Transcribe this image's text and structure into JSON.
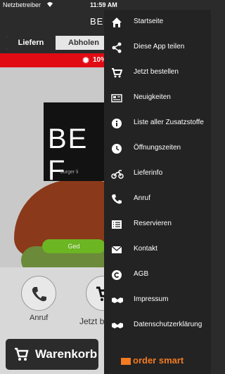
{
  "status": {
    "carrier": "Netzbetreiber",
    "time": "11:59 AM"
  },
  "header": {
    "title": "BE F"
  },
  "tabs": [
    {
      "label": "Liefern",
      "active": true
    },
    {
      "label": "Abholen",
      "active": false
    }
  ],
  "promo": {
    "text": "10%"
  },
  "hero": {
    "logo_big": "BE F",
    "logo_small": "burger li",
    "green_button": "Ged"
  },
  "actions": {
    "call_label": "Anruf",
    "order_label": "Jetzt b"
  },
  "cart": {
    "label": "Warenkorb"
  },
  "drawer": {
    "items": [
      {
        "label": "Startseite",
        "icon": "home-icon"
      },
      {
        "label": "Diese App teilen",
        "icon": "share-icon"
      },
      {
        "label": "Jetzt bestellen",
        "icon": "cart-icon"
      },
      {
        "label": "Neuigkeiten",
        "icon": "news-icon"
      },
      {
        "label": "Liste aller Zusatzstoffe",
        "icon": "info-icon"
      },
      {
        "label": "Öffnungszeiten",
        "icon": "clock-icon"
      },
      {
        "label": "Lieferinfo",
        "icon": "motorbike-icon"
      },
      {
        "label": "Anruf",
        "icon": "phone-icon"
      },
      {
        "label": "Reservieren",
        "icon": "list-icon"
      },
      {
        "label": "Kontakt",
        "icon": "mail-icon"
      },
      {
        "label": "AGB",
        "icon": "copyright-icon"
      },
      {
        "label": "Impressum",
        "icon": "handshake-icon"
      },
      {
        "label": "Datenschutzerklärung",
        "icon": "handshake-icon"
      }
    ],
    "brand": "order smart"
  },
  "colors": {
    "accent_red": "#e10b13",
    "accent_green": "#6cb523",
    "brand_orange": "#f47b20",
    "drawer_bg": "#232323"
  }
}
